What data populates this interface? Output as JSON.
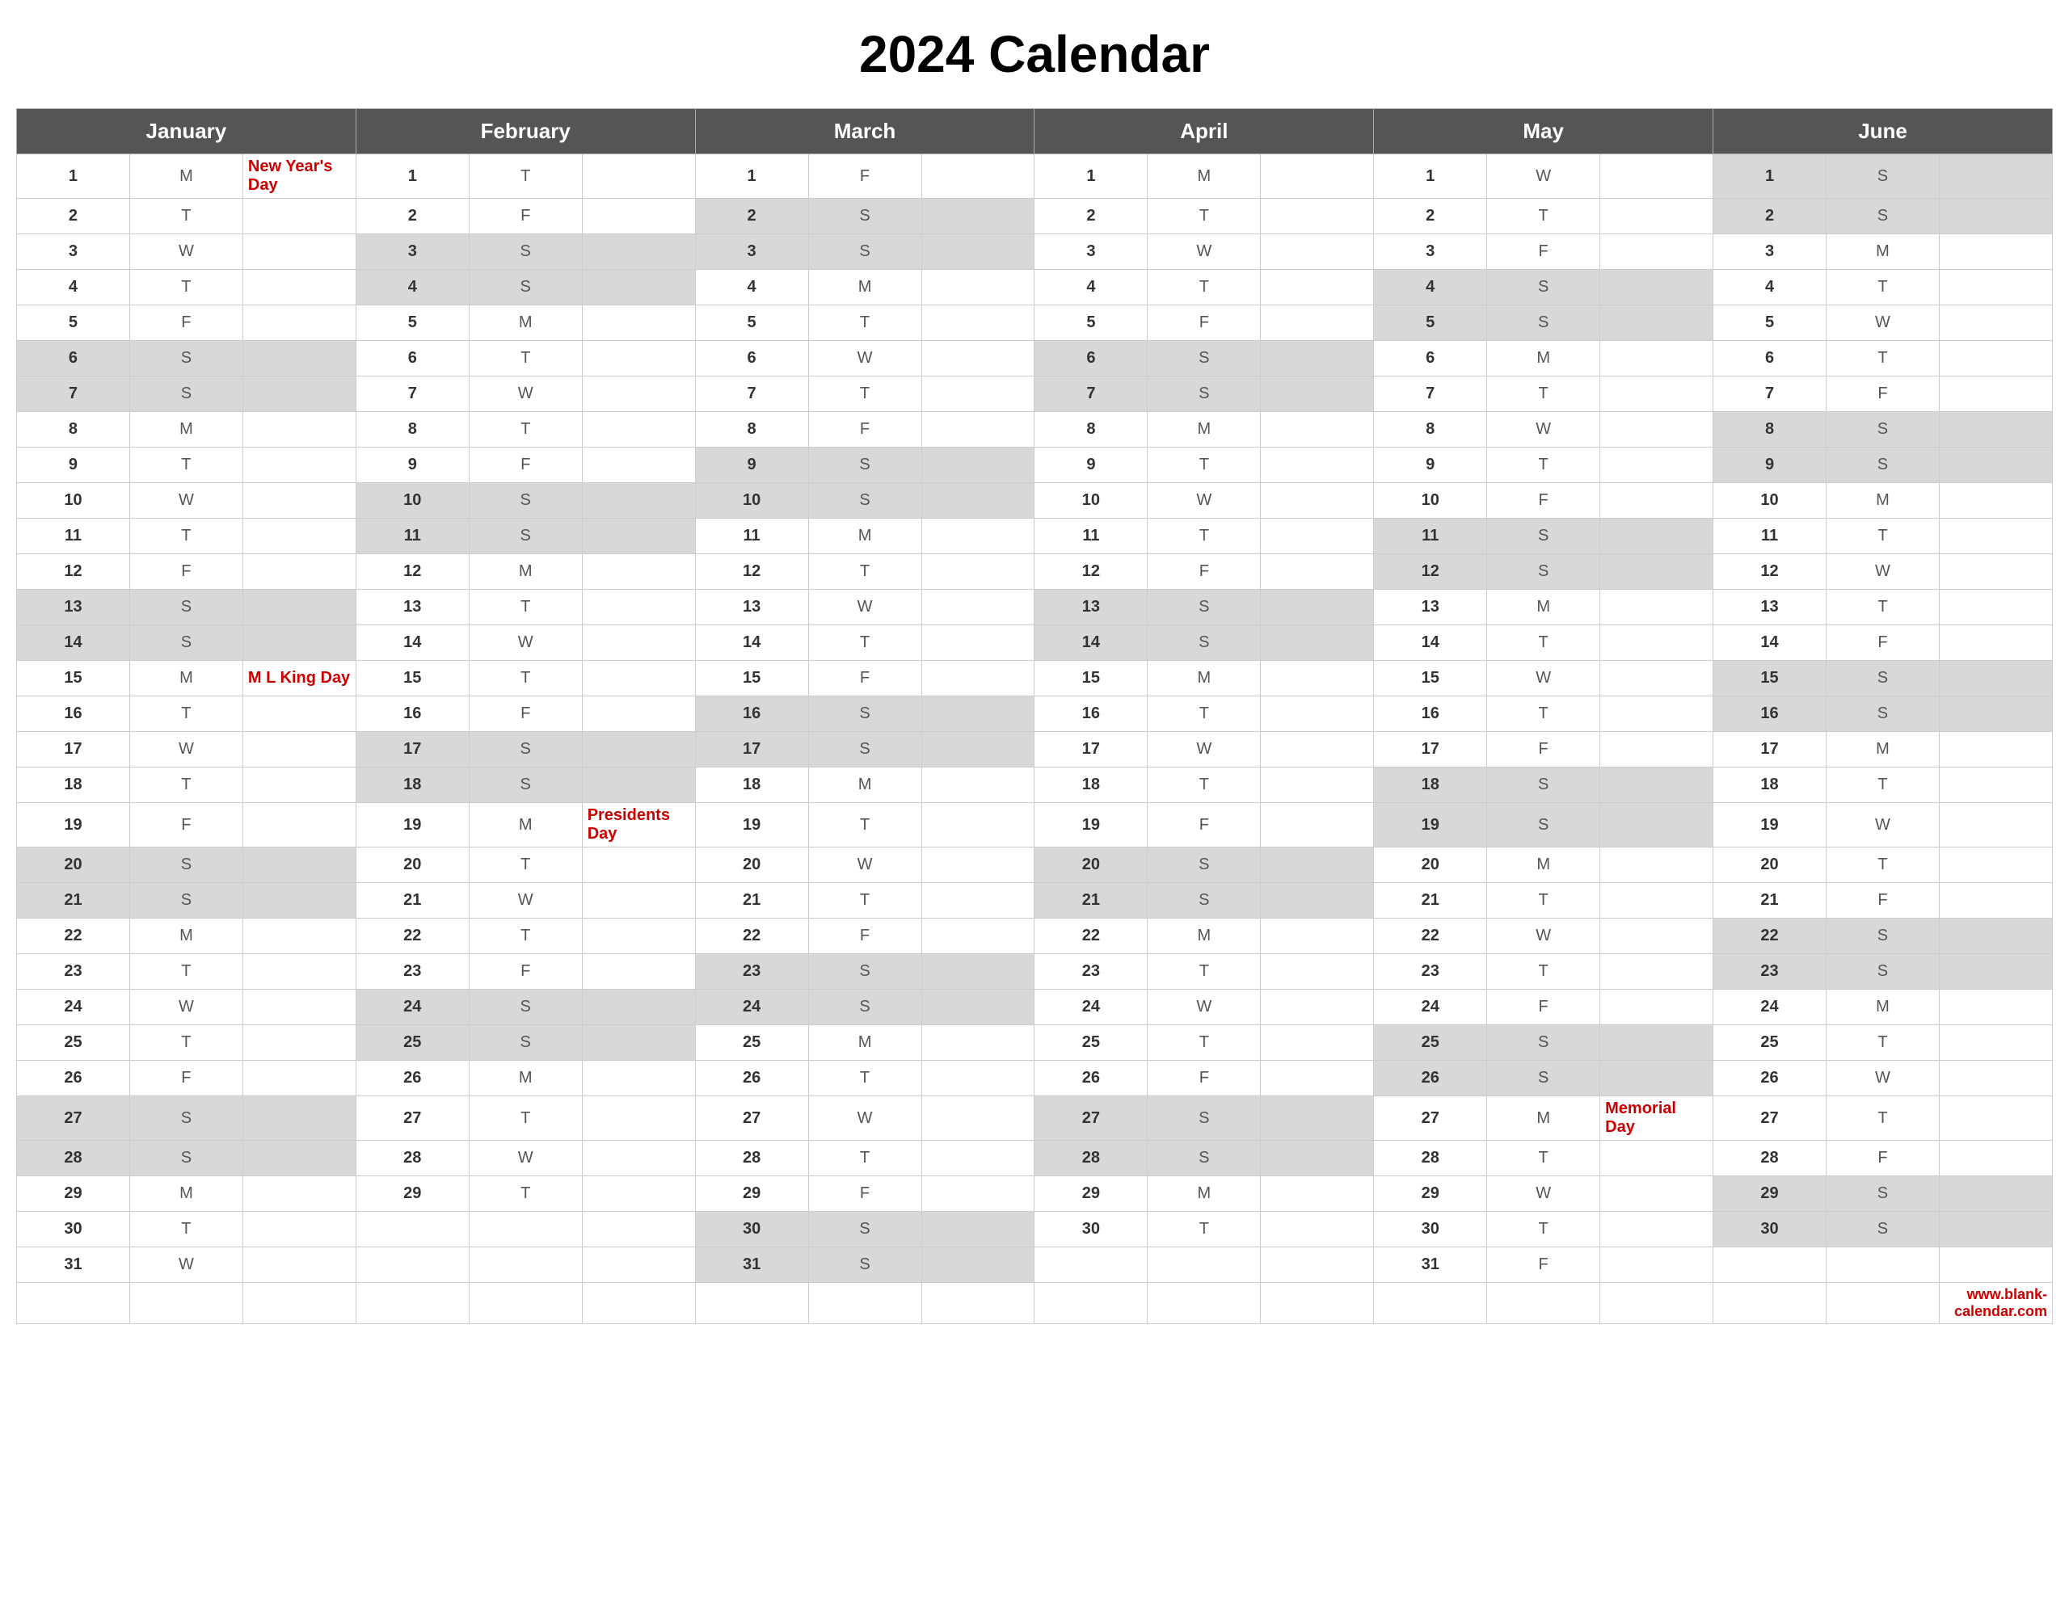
{
  "title": "2024 Calendar",
  "months": [
    "January",
    "February",
    "March",
    "April",
    "May",
    "June"
  ],
  "footer": "www.blank-calendar.com",
  "days": {
    "jan": [
      {
        "d": 1,
        "day": "M",
        "holiday": "New Year's Day",
        "weekend": false
      },
      {
        "d": 2,
        "day": "T",
        "holiday": "",
        "weekend": false
      },
      {
        "d": 3,
        "day": "W",
        "holiday": "",
        "weekend": false
      },
      {
        "d": 4,
        "day": "T",
        "holiday": "",
        "weekend": false
      },
      {
        "d": 5,
        "day": "F",
        "holiday": "",
        "weekend": false
      },
      {
        "d": 6,
        "day": "S",
        "holiday": "",
        "weekend": true
      },
      {
        "d": 7,
        "day": "S",
        "holiday": "",
        "weekend": true
      },
      {
        "d": 8,
        "day": "M",
        "holiday": "",
        "weekend": false
      },
      {
        "d": 9,
        "day": "T",
        "holiday": "",
        "weekend": false
      },
      {
        "d": 10,
        "day": "W",
        "holiday": "",
        "weekend": false
      },
      {
        "d": 11,
        "day": "T",
        "holiday": "",
        "weekend": false
      },
      {
        "d": 12,
        "day": "F",
        "holiday": "",
        "weekend": false
      },
      {
        "d": 13,
        "day": "S",
        "holiday": "",
        "weekend": true
      },
      {
        "d": 14,
        "day": "S",
        "holiday": "",
        "weekend": true
      },
      {
        "d": 15,
        "day": "M",
        "holiday": "M L King Day",
        "weekend": false
      },
      {
        "d": 16,
        "day": "T",
        "holiday": "",
        "weekend": false
      },
      {
        "d": 17,
        "day": "W",
        "holiday": "",
        "weekend": false
      },
      {
        "d": 18,
        "day": "T",
        "holiday": "",
        "weekend": false
      },
      {
        "d": 19,
        "day": "F",
        "holiday": "",
        "weekend": false
      },
      {
        "d": 20,
        "day": "S",
        "holiday": "",
        "weekend": true
      },
      {
        "d": 21,
        "day": "S",
        "holiday": "",
        "weekend": true
      },
      {
        "d": 22,
        "day": "M",
        "holiday": "",
        "weekend": false
      },
      {
        "d": 23,
        "day": "T",
        "holiday": "",
        "weekend": false
      },
      {
        "d": 24,
        "day": "W",
        "holiday": "",
        "weekend": false
      },
      {
        "d": 25,
        "day": "T",
        "holiday": "",
        "weekend": false
      },
      {
        "d": 26,
        "day": "F",
        "holiday": "",
        "weekend": false
      },
      {
        "d": 27,
        "day": "S",
        "holiday": "",
        "weekend": true
      },
      {
        "d": 28,
        "day": "S",
        "holiday": "",
        "weekend": true
      },
      {
        "d": 29,
        "day": "M",
        "holiday": "",
        "weekend": false
      },
      {
        "d": 30,
        "day": "T",
        "holiday": "",
        "weekend": false
      },
      {
        "d": 31,
        "day": "W",
        "holiday": "",
        "weekend": false
      }
    ],
    "feb": [
      {
        "d": 1,
        "day": "T",
        "holiday": "",
        "weekend": false
      },
      {
        "d": 2,
        "day": "F",
        "holiday": "",
        "weekend": false
      },
      {
        "d": 3,
        "day": "S",
        "holiday": "",
        "weekend": true
      },
      {
        "d": 4,
        "day": "S",
        "holiday": "",
        "weekend": true
      },
      {
        "d": 5,
        "day": "M",
        "holiday": "",
        "weekend": false
      },
      {
        "d": 6,
        "day": "T",
        "holiday": "",
        "weekend": false
      },
      {
        "d": 7,
        "day": "W",
        "holiday": "",
        "weekend": false
      },
      {
        "d": 8,
        "day": "T",
        "holiday": "",
        "weekend": false
      },
      {
        "d": 9,
        "day": "F",
        "holiday": "",
        "weekend": false
      },
      {
        "d": 10,
        "day": "S",
        "holiday": "",
        "weekend": true
      },
      {
        "d": 11,
        "day": "S",
        "holiday": "",
        "weekend": true
      },
      {
        "d": 12,
        "day": "M",
        "holiday": "",
        "weekend": false
      },
      {
        "d": 13,
        "day": "T",
        "holiday": "",
        "weekend": false
      },
      {
        "d": 14,
        "day": "W",
        "holiday": "",
        "weekend": false
      },
      {
        "d": 15,
        "day": "T",
        "holiday": "",
        "weekend": false
      },
      {
        "d": 16,
        "day": "F",
        "holiday": "",
        "weekend": false
      },
      {
        "d": 17,
        "day": "S",
        "holiday": "",
        "weekend": true
      },
      {
        "d": 18,
        "day": "S",
        "holiday": "",
        "weekend": true
      },
      {
        "d": 19,
        "day": "M",
        "holiday": "Presidents Day",
        "weekend": false
      },
      {
        "d": 20,
        "day": "T",
        "holiday": "",
        "weekend": false
      },
      {
        "d": 21,
        "day": "W",
        "holiday": "",
        "weekend": false
      },
      {
        "d": 22,
        "day": "T",
        "holiday": "",
        "weekend": false
      },
      {
        "d": 23,
        "day": "F",
        "holiday": "",
        "weekend": false
      },
      {
        "d": 24,
        "day": "S",
        "holiday": "",
        "weekend": true
      },
      {
        "d": 25,
        "day": "S",
        "holiday": "",
        "weekend": true
      },
      {
        "d": 26,
        "day": "M",
        "holiday": "",
        "weekend": false
      },
      {
        "d": 27,
        "day": "T",
        "holiday": "",
        "weekend": false
      },
      {
        "d": 28,
        "day": "W",
        "holiday": "",
        "weekend": false
      },
      {
        "d": 29,
        "day": "T",
        "holiday": "",
        "weekend": false
      }
    ],
    "mar": [
      {
        "d": 1,
        "day": "F",
        "holiday": "",
        "weekend": false
      },
      {
        "d": 2,
        "day": "S",
        "holiday": "",
        "weekend": true
      },
      {
        "d": 3,
        "day": "S",
        "holiday": "",
        "weekend": true
      },
      {
        "d": 4,
        "day": "M",
        "holiday": "",
        "weekend": false
      },
      {
        "d": 5,
        "day": "T",
        "holiday": "",
        "weekend": false
      },
      {
        "d": 6,
        "day": "W",
        "holiday": "",
        "weekend": false
      },
      {
        "d": 7,
        "day": "T",
        "holiday": "",
        "weekend": false
      },
      {
        "d": 8,
        "day": "F",
        "holiday": "",
        "weekend": false
      },
      {
        "d": 9,
        "day": "S",
        "holiday": "",
        "weekend": true
      },
      {
        "d": 10,
        "day": "S",
        "holiday": "",
        "weekend": true
      },
      {
        "d": 11,
        "day": "M",
        "holiday": "",
        "weekend": false
      },
      {
        "d": 12,
        "day": "T",
        "holiday": "",
        "weekend": false
      },
      {
        "d": 13,
        "day": "W",
        "holiday": "",
        "weekend": false
      },
      {
        "d": 14,
        "day": "T",
        "holiday": "",
        "weekend": false
      },
      {
        "d": 15,
        "day": "F",
        "holiday": "",
        "weekend": false
      },
      {
        "d": 16,
        "day": "S",
        "holiday": "",
        "weekend": true
      },
      {
        "d": 17,
        "day": "S",
        "holiday": "",
        "weekend": true
      },
      {
        "d": 18,
        "day": "M",
        "holiday": "",
        "weekend": false
      },
      {
        "d": 19,
        "day": "T",
        "holiday": "",
        "weekend": false
      },
      {
        "d": 20,
        "day": "W",
        "holiday": "",
        "weekend": false
      },
      {
        "d": 21,
        "day": "T",
        "holiday": "",
        "weekend": false
      },
      {
        "d": 22,
        "day": "F",
        "holiday": "",
        "weekend": false
      },
      {
        "d": 23,
        "day": "S",
        "holiday": "",
        "weekend": true
      },
      {
        "d": 24,
        "day": "S",
        "holiday": "",
        "weekend": true
      },
      {
        "d": 25,
        "day": "M",
        "holiday": "",
        "weekend": false
      },
      {
        "d": 26,
        "day": "T",
        "holiday": "",
        "weekend": false
      },
      {
        "d": 27,
        "day": "W",
        "holiday": "",
        "weekend": false
      },
      {
        "d": 28,
        "day": "T",
        "holiday": "",
        "weekend": false
      },
      {
        "d": 29,
        "day": "F",
        "holiday": "",
        "weekend": false
      },
      {
        "d": 30,
        "day": "S",
        "holiday": "",
        "weekend": true
      },
      {
        "d": 31,
        "day": "S",
        "holiday": "",
        "weekend": true
      }
    ],
    "apr": [
      {
        "d": 1,
        "day": "M",
        "holiday": "",
        "weekend": false
      },
      {
        "d": 2,
        "day": "T",
        "holiday": "",
        "weekend": false
      },
      {
        "d": 3,
        "day": "W",
        "holiday": "",
        "weekend": false
      },
      {
        "d": 4,
        "day": "T",
        "holiday": "",
        "weekend": false
      },
      {
        "d": 5,
        "day": "F",
        "holiday": "",
        "weekend": false
      },
      {
        "d": 6,
        "day": "S",
        "holiday": "",
        "weekend": true
      },
      {
        "d": 7,
        "day": "S",
        "holiday": "",
        "weekend": true
      },
      {
        "d": 8,
        "day": "M",
        "holiday": "",
        "weekend": false
      },
      {
        "d": 9,
        "day": "T",
        "holiday": "",
        "weekend": false
      },
      {
        "d": 10,
        "day": "W",
        "holiday": "",
        "weekend": false
      },
      {
        "d": 11,
        "day": "T",
        "holiday": "",
        "weekend": false
      },
      {
        "d": 12,
        "day": "F",
        "holiday": "",
        "weekend": false
      },
      {
        "d": 13,
        "day": "S",
        "holiday": "",
        "weekend": true
      },
      {
        "d": 14,
        "day": "S",
        "holiday": "",
        "weekend": true
      },
      {
        "d": 15,
        "day": "M",
        "holiday": "",
        "weekend": false
      },
      {
        "d": 16,
        "day": "T",
        "holiday": "",
        "weekend": false
      },
      {
        "d": 17,
        "day": "W",
        "holiday": "",
        "weekend": false
      },
      {
        "d": 18,
        "day": "T",
        "holiday": "",
        "weekend": false
      },
      {
        "d": 19,
        "day": "F",
        "holiday": "",
        "weekend": false
      },
      {
        "d": 20,
        "day": "S",
        "holiday": "",
        "weekend": true
      },
      {
        "d": 21,
        "day": "S",
        "holiday": "",
        "weekend": true
      },
      {
        "d": 22,
        "day": "M",
        "holiday": "",
        "weekend": false
      },
      {
        "d": 23,
        "day": "T",
        "holiday": "",
        "weekend": false
      },
      {
        "d": 24,
        "day": "W",
        "holiday": "",
        "weekend": false
      },
      {
        "d": 25,
        "day": "T",
        "holiday": "",
        "weekend": false
      },
      {
        "d": 26,
        "day": "F",
        "holiday": "",
        "weekend": false
      },
      {
        "d": 27,
        "day": "S",
        "holiday": "",
        "weekend": true
      },
      {
        "d": 28,
        "day": "S",
        "holiday": "",
        "weekend": true
      },
      {
        "d": 29,
        "day": "M",
        "holiday": "",
        "weekend": false
      },
      {
        "d": 30,
        "day": "T",
        "holiday": "",
        "weekend": false
      }
    ],
    "may": [
      {
        "d": 1,
        "day": "W",
        "holiday": "",
        "weekend": false
      },
      {
        "d": 2,
        "day": "T",
        "holiday": "",
        "weekend": false
      },
      {
        "d": 3,
        "day": "F",
        "holiday": "",
        "weekend": false
      },
      {
        "d": 4,
        "day": "S",
        "holiday": "",
        "weekend": true
      },
      {
        "d": 5,
        "day": "S",
        "holiday": "",
        "weekend": true
      },
      {
        "d": 6,
        "day": "M",
        "holiday": "",
        "weekend": false
      },
      {
        "d": 7,
        "day": "T",
        "holiday": "",
        "weekend": false
      },
      {
        "d": 8,
        "day": "W",
        "holiday": "",
        "weekend": false
      },
      {
        "d": 9,
        "day": "T",
        "holiday": "",
        "weekend": false
      },
      {
        "d": 10,
        "day": "F",
        "holiday": "",
        "weekend": false
      },
      {
        "d": 11,
        "day": "S",
        "holiday": "",
        "weekend": true
      },
      {
        "d": 12,
        "day": "S",
        "holiday": "",
        "weekend": true
      },
      {
        "d": 13,
        "day": "M",
        "holiday": "",
        "weekend": false
      },
      {
        "d": 14,
        "day": "T",
        "holiday": "",
        "weekend": false
      },
      {
        "d": 15,
        "day": "W",
        "holiday": "",
        "weekend": false
      },
      {
        "d": 16,
        "day": "T",
        "holiday": "",
        "weekend": false
      },
      {
        "d": 17,
        "day": "F",
        "holiday": "",
        "weekend": false
      },
      {
        "d": 18,
        "day": "S",
        "holiday": "",
        "weekend": true
      },
      {
        "d": 19,
        "day": "S",
        "holiday": "",
        "weekend": true
      },
      {
        "d": 20,
        "day": "M",
        "holiday": "",
        "weekend": false
      },
      {
        "d": 21,
        "day": "T",
        "holiday": "",
        "weekend": false
      },
      {
        "d": 22,
        "day": "W",
        "holiday": "",
        "weekend": false
      },
      {
        "d": 23,
        "day": "T",
        "holiday": "",
        "weekend": false
      },
      {
        "d": 24,
        "day": "F",
        "holiday": "",
        "weekend": false
      },
      {
        "d": 25,
        "day": "S",
        "holiday": "",
        "weekend": true
      },
      {
        "d": 26,
        "day": "S",
        "holiday": "",
        "weekend": true
      },
      {
        "d": 27,
        "day": "M",
        "holiday": "Memorial Day",
        "weekend": false
      },
      {
        "d": 28,
        "day": "T",
        "holiday": "",
        "weekend": false
      },
      {
        "d": 29,
        "day": "W",
        "holiday": "",
        "weekend": false
      },
      {
        "d": 30,
        "day": "T",
        "holiday": "",
        "weekend": false
      },
      {
        "d": 31,
        "day": "F",
        "holiday": "",
        "weekend": false
      }
    ],
    "jun": [
      {
        "d": 1,
        "day": "S",
        "holiday": "",
        "weekend": true
      },
      {
        "d": 2,
        "day": "S",
        "holiday": "",
        "weekend": true
      },
      {
        "d": 3,
        "day": "M",
        "holiday": "",
        "weekend": false
      },
      {
        "d": 4,
        "day": "T",
        "holiday": "",
        "weekend": false
      },
      {
        "d": 5,
        "day": "W",
        "holiday": "",
        "weekend": false
      },
      {
        "d": 6,
        "day": "T",
        "holiday": "",
        "weekend": false
      },
      {
        "d": 7,
        "day": "F",
        "holiday": "",
        "weekend": false
      },
      {
        "d": 8,
        "day": "S",
        "holiday": "",
        "weekend": true
      },
      {
        "d": 9,
        "day": "S",
        "holiday": "",
        "weekend": true
      },
      {
        "d": 10,
        "day": "M",
        "holiday": "",
        "weekend": false
      },
      {
        "d": 11,
        "day": "T",
        "holiday": "",
        "weekend": false
      },
      {
        "d": 12,
        "day": "W",
        "holiday": "",
        "weekend": false
      },
      {
        "d": 13,
        "day": "T",
        "holiday": "",
        "weekend": false
      },
      {
        "d": 14,
        "day": "F",
        "holiday": "",
        "weekend": false
      },
      {
        "d": 15,
        "day": "S",
        "holiday": "",
        "weekend": true
      },
      {
        "d": 16,
        "day": "S",
        "holiday": "",
        "weekend": true
      },
      {
        "d": 17,
        "day": "M",
        "holiday": "",
        "weekend": false
      },
      {
        "d": 18,
        "day": "T",
        "holiday": "",
        "weekend": false
      },
      {
        "d": 19,
        "day": "W",
        "holiday": "",
        "weekend": false
      },
      {
        "d": 20,
        "day": "T",
        "holiday": "",
        "weekend": false
      },
      {
        "d": 21,
        "day": "F",
        "holiday": "",
        "weekend": false
      },
      {
        "d": 22,
        "day": "S",
        "holiday": "",
        "weekend": true
      },
      {
        "d": 23,
        "day": "S",
        "holiday": "",
        "weekend": true
      },
      {
        "d": 24,
        "day": "M",
        "holiday": "",
        "weekend": false
      },
      {
        "d": 25,
        "day": "T",
        "holiday": "",
        "weekend": false
      },
      {
        "d": 26,
        "day": "W",
        "holiday": "",
        "weekend": false
      },
      {
        "d": 27,
        "day": "T",
        "holiday": "",
        "weekend": false
      },
      {
        "d": 28,
        "day": "F",
        "holiday": "",
        "weekend": false
      },
      {
        "d": 29,
        "day": "S",
        "holiday": "",
        "weekend": true
      },
      {
        "d": 30,
        "day": "S",
        "holiday": "",
        "weekend": true
      }
    ]
  }
}
